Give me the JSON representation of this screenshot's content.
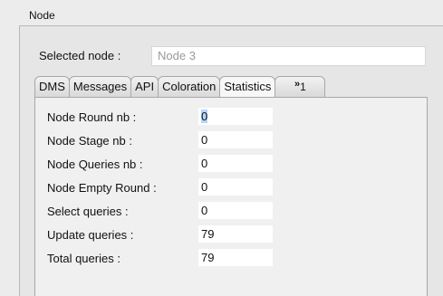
{
  "group": {
    "title": "Node"
  },
  "selected": {
    "label": "Selected node :",
    "value": "Node 3"
  },
  "tabs": [
    {
      "label": "DMS"
    },
    {
      "label": "Messages"
    },
    {
      "label": "API"
    },
    {
      "label": "Coloration"
    },
    {
      "label": "Statistics"
    }
  ],
  "tabs_overflow": {
    "arrow": "»",
    "count": "1"
  },
  "stats": [
    {
      "label": "Node Round nb :",
      "value": "0"
    },
    {
      "label": "Node Stage nb :",
      "value": "0"
    },
    {
      "label": "Node Queries nb :",
      "value": "0"
    },
    {
      "label": "Node Empty Round :",
      "value": "0"
    },
    {
      "label": "Select queries :",
      "value": "0"
    },
    {
      "label": "Update queries :",
      "value": "79"
    },
    {
      "label": "Total queries :",
      "value": "79"
    }
  ]
}
